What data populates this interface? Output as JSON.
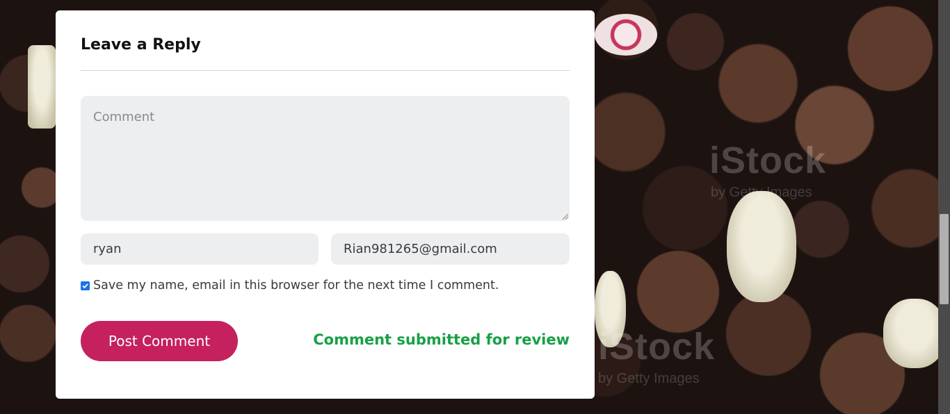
{
  "background": {
    "watermarks": [
      "iStock",
      "by Getty Images"
    ]
  },
  "form": {
    "title": "Leave a Reply",
    "comment_placeholder": "Comment",
    "name_value": "ryan",
    "email_value": "Rian981265@gmail.com",
    "save_checkbox_checked": true,
    "save_label": "Save my name, email in this browser for the next time I comment.",
    "post_button_label": "Post Comment",
    "status_message": "Comment submitted for review"
  },
  "colors": {
    "button": "#c4215e",
    "status_success": "#18a046",
    "input_bg": "#edeeef",
    "checkbox": "#1a73e8"
  }
}
